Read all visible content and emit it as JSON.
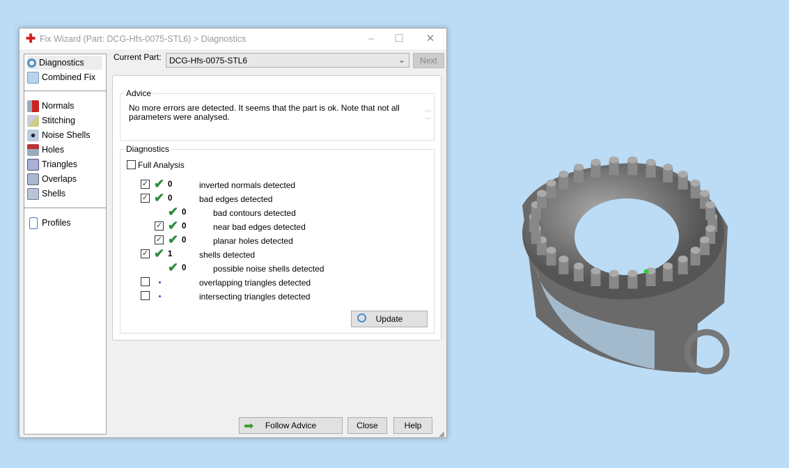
{
  "window": {
    "title": "Fix Wizard (Part: DCG-Hfs-0075-STL6) > Diagnostics",
    "minimize": "–",
    "maximize": "☐",
    "close": "✕"
  },
  "sidebar": {
    "items": [
      {
        "label": "Diagnostics",
        "icon": "magnifier-icon",
        "selected": true
      },
      {
        "label": "Combined Fix",
        "icon": "cube-stack-icon"
      },
      {
        "label": "Normals",
        "icon": "cube-red-icon"
      },
      {
        "label": "Stitching",
        "icon": "cube-stitch-icon"
      },
      {
        "label": "Noise Shells",
        "icon": "dice-icon"
      },
      {
        "label": "Holes",
        "icon": "cube-hole-icon"
      },
      {
        "label": "Triangles",
        "icon": "cube-triangles-icon"
      },
      {
        "label": "Overlaps",
        "icon": "cube-overlap-icon"
      },
      {
        "label": "Shells",
        "icon": "cube-shell-icon"
      },
      {
        "label": "Profiles",
        "icon": "document-icon"
      }
    ]
  },
  "current_part": {
    "label": "Current Part:",
    "value": "DCG-Hfs-0075-STL6",
    "next": "Next"
  },
  "advice": {
    "legend": "Advice",
    "text": "No more errors are detected. It seems that the part is ok. Note that not all parameters were analysed."
  },
  "diagnostics": {
    "legend": "Diagnostics",
    "full_analysis": "Full Analysis",
    "full_analysis_checked": false,
    "rows": [
      {
        "checkbox": true,
        "checked": true,
        "status": "ok",
        "count": "0",
        "label": "inverted normals detected",
        "indent": 0
      },
      {
        "checkbox": true,
        "checked": true,
        "status": "ok",
        "count": "0",
        "label": "bad edges detected",
        "indent": 0
      },
      {
        "checkbox": false,
        "status": "ok",
        "count": "0",
        "label": "bad contours detected",
        "indent": 1
      },
      {
        "checkbox": true,
        "checked": true,
        "status": "ok",
        "count": "0",
        "label": "near bad edges detected",
        "indent": 1
      },
      {
        "checkbox": true,
        "checked": true,
        "status": "ok",
        "count": "0",
        "label": "planar holes detected",
        "indent": 1
      },
      {
        "checkbox": true,
        "checked": true,
        "status": "ok",
        "count": "1",
        "label": "shells detected",
        "indent": 0
      },
      {
        "checkbox": false,
        "status": "ok",
        "count": "0",
        "label": "possible noise shells detected",
        "indent": 1
      },
      {
        "checkbox": true,
        "checked": false,
        "status": "unknown",
        "count": "",
        "label": "overlapping triangles detected",
        "indent": 0
      },
      {
        "checkbox": true,
        "checked": false,
        "status": "unknown",
        "count": "",
        "label": "intersecting triangles detected",
        "indent": 0
      }
    ],
    "update": "Update"
  },
  "footer": {
    "follow_advice": "Follow Advice",
    "close": "Close",
    "help": "Help"
  },
  "colors": {
    "check": "#2e8b3e",
    "background": "#bcdcf6",
    "model": "#6e6e6e"
  }
}
